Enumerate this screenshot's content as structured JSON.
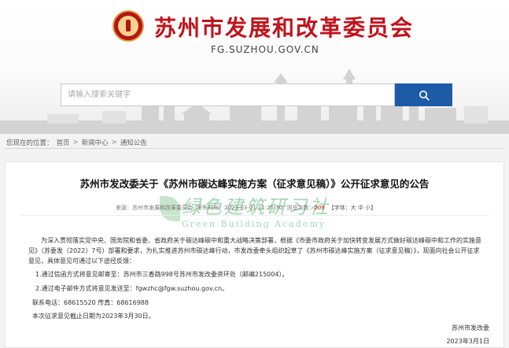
{
  "site": {
    "title": "苏州市发展和改革委员会",
    "url": "FG.SUZHOU.GOV.CN"
  },
  "search": {
    "placeholder": "请输入搜索关键字",
    "button_icon": "search-icon"
  },
  "breadcrumb": {
    "prefix": "您现在的位置：",
    "items": [
      "首页",
      "新闻中心",
      "通知公告"
    ],
    "separator": ">"
  },
  "article": {
    "title": "苏州市发改委关于《苏州市碳达峰实施方案（征求意见稿）》公开征求意见的公告",
    "meta": {
      "source_label": "来源：",
      "source_value": "苏州市发展和改革委员会",
      "date_label": "发布时间：",
      "date_value": "2023-03-01 11:25:30",
      "views_label": "浏览次数：",
      "views_value": "209",
      "font_label": "【字体：",
      "font_large": "大",
      "font_medium": "中",
      "font_small": "小",
      "font_end": "】"
    },
    "paragraph1": "为深入贯彻落实党中央、国务院和省委、省政府关于碳达峰碳中和重大战略决策部署，根据《市委市政府关于加快转变发展方式做好碳达峰碳中和工作的实施意见》（苏委发〔2022〕7号）部署和要求，为扎实推进苏州市碳达峰行动，市发改委牵头组织起草了《苏州市碳达峰实施方案（征求意见稿）》，现面向社会公开征求意见，具体意见可通过以下途径反馈：",
    "item1": "1.通过信函方式将意见邮寄至：苏州市三香路998号苏州市发改委资环处（邮编215004）。",
    "item2": "2.通过电子邮件方式将意见发送至：fgwzhc@fgw.suzhou.gov.cn。",
    "contact": "联系电话：68615520  传真：68616988",
    "deadline": "本次征求意见截止日期为2023年3月30日。",
    "signature": "苏州市发改委",
    "sign_date": "2023年3月1日"
  },
  "watermark": {
    "cn": "绿色建筑研习社",
    "en": "Green Building Academy"
  },
  "colors": {
    "brand_red": "#c1121b",
    "search_blue": "#1d5ba8",
    "watermark_green": "#3aa35a"
  }
}
